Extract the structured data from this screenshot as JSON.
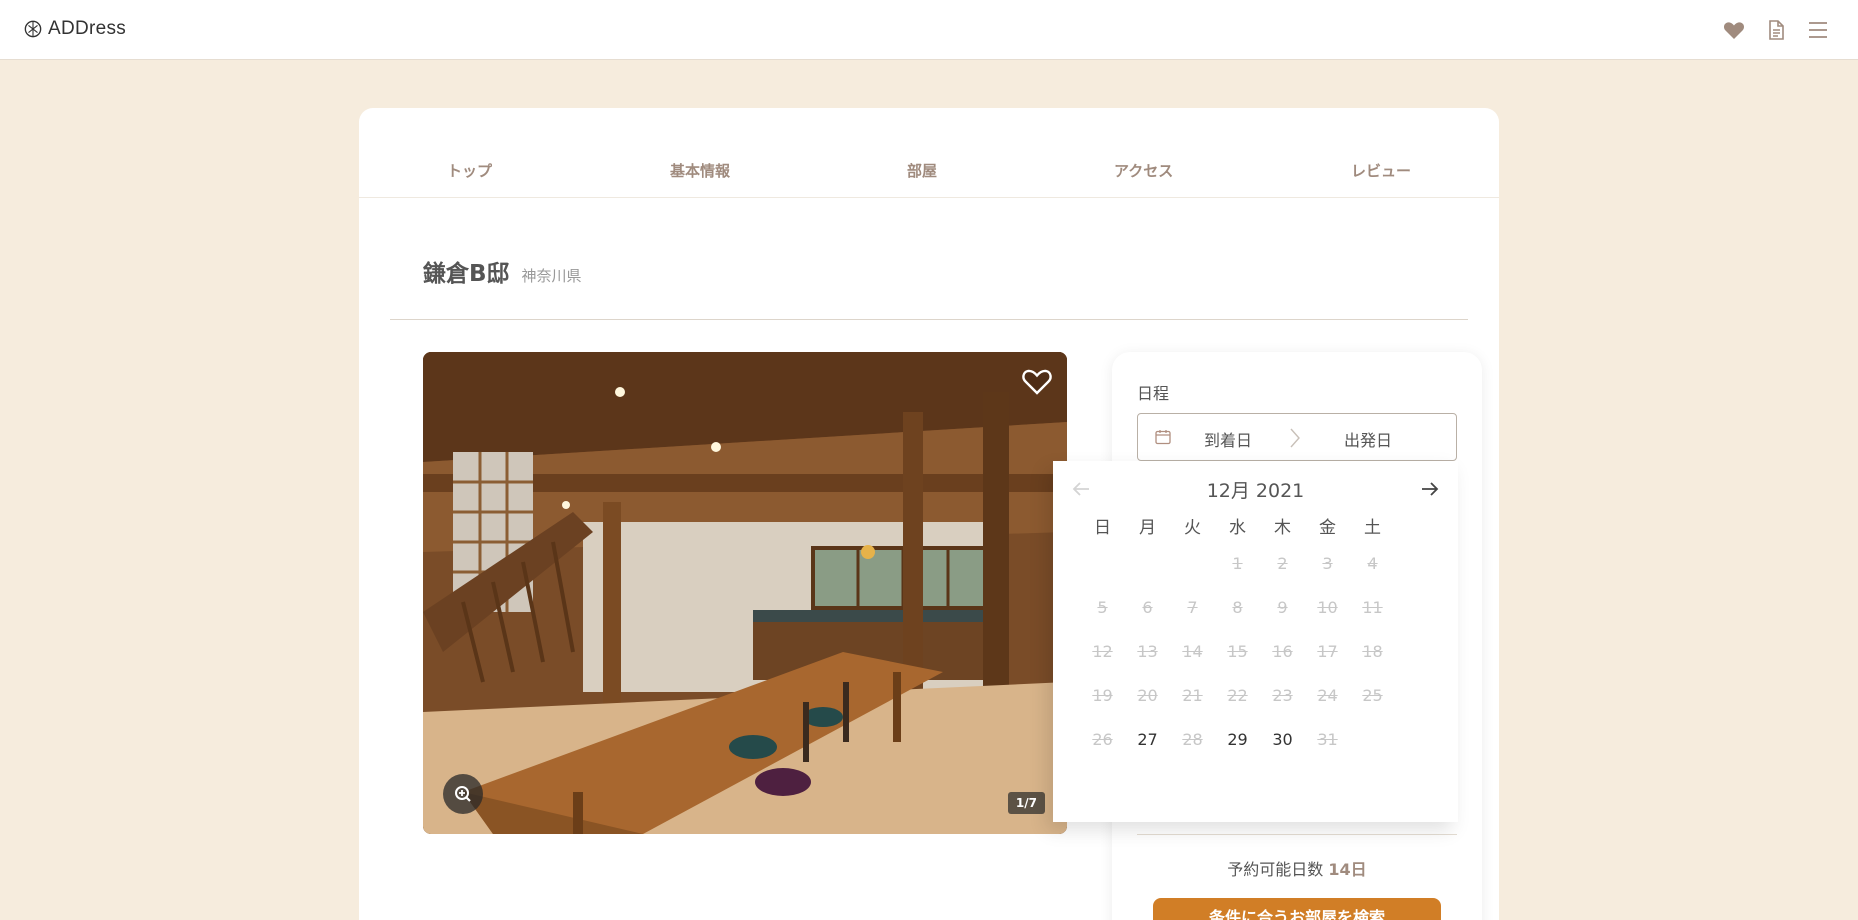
{
  "header": {
    "logo_text": "ADDress",
    "icons": [
      "heart-icon",
      "document-icon",
      "menu-icon"
    ]
  },
  "tabs": [
    {
      "label": "トップ"
    },
    {
      "label": "基本情報"
    },
    {
      "label": "部屋"
    },
    {
      "label": "アクセス"
    },
    {
      "label": "レビュー"
    }
  ],
  "property": {
    "name": "鎌倉B邸",
    "prefecture": "神奈川県"
  },
  "gallery": {
    "counter": "1/7"
  },
  "booking": {
    "schedule_label": "日程",
    "arrival_placeholder": "到着日",
    "departure_placeholder": "出発日",
    "available_label": "予約可能日数",
    "available_value": "14日",
    "search_button": "条件に合うお部屋を検索"
  },
  "calendar": {
    "month_label": "12月 2021",
    "weekdays": [
      "日",
      "月",
      "火",
      "水",
      "木",
      "金",
      "土"
    ],
    "days": [
      {
        "d": "",
        "enabled": false
      },
      {
        "d": "",
        "enabled": false
      },
      {
        "d": "",
        "enabled": false
      },
      {
        "d": "1",
        "enabled": false
      },
      {
        "d": "2",
        "enabled": false
      },
      {
        "d": "3",
        "enabled": false
      },
      {
        "d": "4",
        "enabled": false
      },
      {
        "d": "5",
        "enabled": false
      },
      {
        "d": "6",
        "enabled": false
      },
      {
        "d": "7",
        "enabled": false
      },
      {
        "d": "8",
        "enabled": false
      },
      {
        "d": "9",
        "enabled": false
      },
      {
        "d": "10",
        "enabled": false
      },
      {
        "d": "11",
        "enabled": false
      },
      {
        "d": "12",
        "enabled": false
      },
      {
        "d": "13",
        "enabled": false
      },
      {
        "d": "14",
        "enabled": false
      },
      {
        "d": "15",
        "enabled": false
      },
      {
        "d": "16",
        "enabled": false
      },
      {
        "d": "17",
        "enabled": false
      },
      {
        "d": "18",
        "enabled": false
      },
      {
        "d": "19",
        "enabled": false
      },
      {
        "d": "20",
        "enabled": false
      },
      {
        "d": "21",
        "enabled": false
      },
      {
        "d": "22",
        "enabled": false
      },
      {
        "d": "23",
        "enabled": false
      },
      {
        "d": "24",
        "enabled": false
      },
      {
        "d": "25",
        "enabled": false
      },
      {
        "d": "26",
        "enabled": false
      },
      {
        "d": "27",
        "enabled": true
      },
      {
        "d": "28",
        "enabled": false
      },
      {
        "d": "29",
        "enabled": true
      },
      {
        "d": "30",
        "enabled": true
      },
      {
        "d": "31",
        "enabled": false
      }
    ]
  },
  "colors": {
    "background": "#f6ecdd",
    "accent": "#d17e26",
    "tab_text": "#a08b7e",
    "heart": "#a08b7e"
  }
}
